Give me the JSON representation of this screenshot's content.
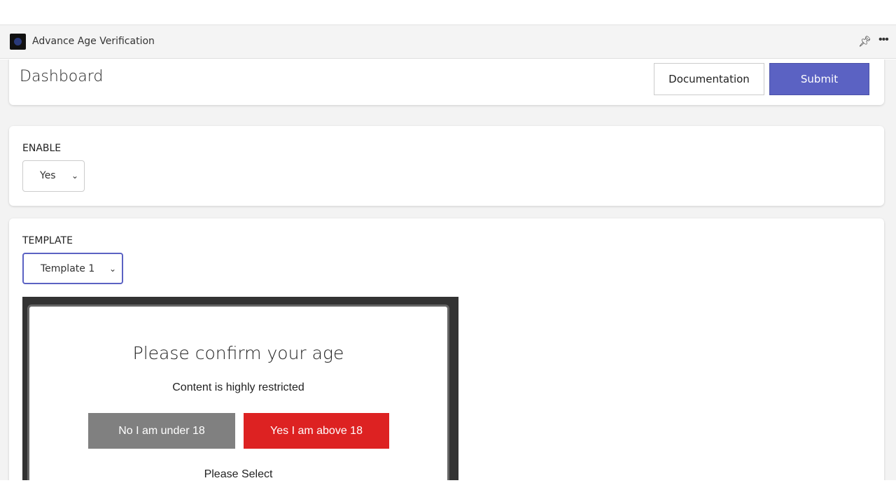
{
  "app": {
    "title": "Advance Age Verification"
  },
  "header": {
    "title": "Dashboard",
    "documentation_label": "Documentation",
    "submit_label": "Submit"
  },
  "enable": {
    "label": "ENABLE",
    "value": "Yes"
  },
  "template": {
    "label": "TEMPLATE",
    "value": "Template 1"
  },
  "preview": {
    "title": "Please confirm your age",
    "subtitle": "Content is highly restricted",
    "no_label": "No I am under 18",
    "yes_label": "Yes I am above 18",
    "footer": "Please Select"
  },
  "colors": {
    "accent": "#5b62c3",
    "yes": "#dd2222",
    "no": "#808080"
  }
}
